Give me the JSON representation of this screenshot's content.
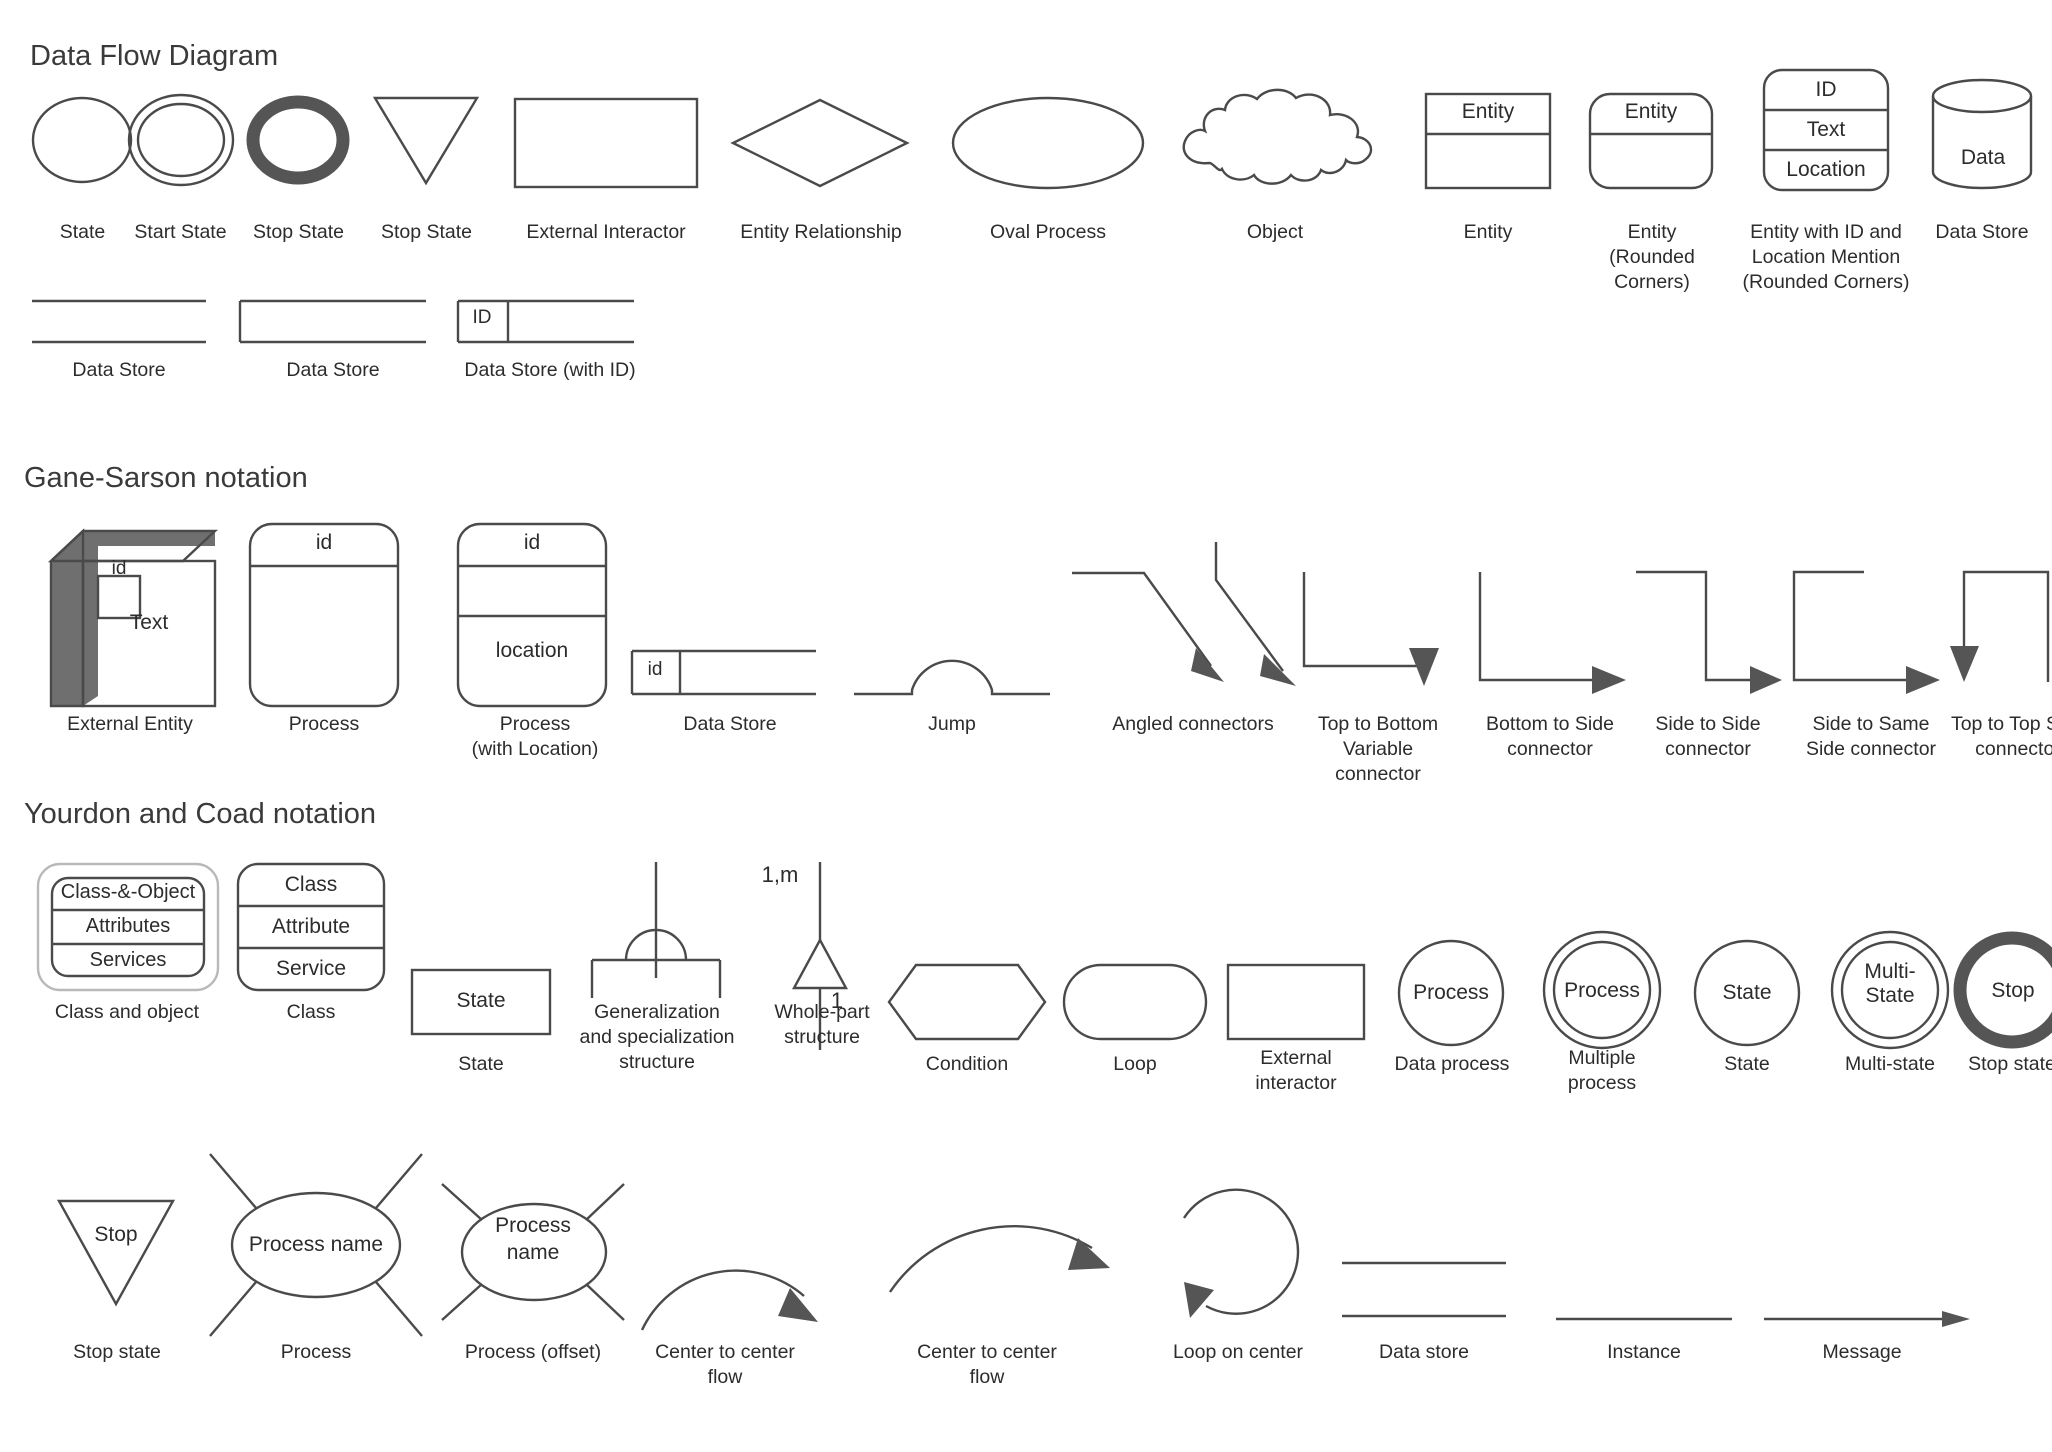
{
  "sections": [
    {
      "id": "dfd",
      "title": "Data Flow Diagram"
    },
    {
      "id": "gane",
      "title": "Gane-Sarson notation"
    },
    {
      "id": "yourdon",
      "title": "Yourdon and Coad notation"
    }
  ],
  "dfd": {
    "row1": [
      {
        "caption": "State",
        "shape": "ellipse"
      },
      {
        "caption": "Start State",
        "shape": "double-ellipse"
      },
      {
        "caption": "Stop State",
        "shape": "thick-ellipse"
      },
      {
        "caption": "Stop State",
        "shape": "down-triangle"
      },
      {
        "caption": "External Interactor",
        "shape": "rectangle"
      },
      {
        "caption": "Entity Relationship",
        "shape": "diamond"
      },
      {
        "caption": "Oval Process",
        "shape": "oval"
      },
      {
        "caption": "Object",
        "shape": "cloud"
      },
      {
        "caption": "Entity",
        "shape": "entity-box",
        "inner": "Entity"
      },
      {
        "caption": "Entity\n(Rounded Corners)",
        "shape": "entity-box-rounded",
        "inner": "Entity"
      },
      {
        "caption": "Entity with ID and\nLocation Mention\n(Rounded Corners)",
        "shape": "entity-three-rows",
        "rows": [
          "ID",
          "Text",
          "Location"
        ]
      },
      {
        "caption": "Data Store",
        "shape": "cylinder",
        "inner": "Data"
      }
    ],
    "row2": [
      {
        "caption": "Data Store",
        "shape": "two-lines"
      },
      {
        "caption": "Data Store",
        "shape": "open-rect"
      },
      {
        "caption": "Data Store (with ID)",
        "shape": "open-rect-id",
        "inner": "ID"
      }
    ]
  },
  "gane": {
    "items": [
      {
        "caption": "External Entity",
        "shape": "cube-3d",
        "inner_id": "id",
        "inner_text": "Text"
      },
      {
        "caption": "Process",
        "shape": "process-2row",
        "rows": [
          "id"
        ]
      },
      {
        "caption": "Process\n(with Location)",
        "shape": "process-3row",
        "rows": [
          "id",
          "",
          "location"
        ]
      },
      {
        "caption": "Data Store",
        "shape": "gane-datastore",
        "inner": "id"
      },
      {
        "caption": "Jump",
        "shape": "jump"
      },
      {
        "caption": "Angled connectors",
        "shape": "angled-connectors"
      },
      {
        "caption": "Top to Bottom\nVariable\nconnector",
        "shape": "top-to-bottom-variable"
      },
      {
        "caption": "Bottom to Side\nconnector",
        "shape": "bottom-to-side"
      },
      {
        "caption": "Side to Side\nconnector",
        "shape": "side-to-side"
      },
      {
        "caption": "Side to Same\nSide connector",
        "shape": "side-to-same-side"
      },
      {
        "caption": "Top to Top Side\nconnector",
        "shape": "top-to-top-side"
      }
    ]
  },
  "yourdon": {
    "row1": [
      {
        "caption": "Class and object",
        "shape": "class-and-object",
        "rows": [
          "Class-&-Object",
          "Attributes",
          "Services"
        ]
      },
      {
        "caption": "Class",
        "shape": "class-box",
        "rows": [
          "Class",
          "Attribute",
          "Service"
        ]
      },
      {
        "caption": "State",
        "shape": "state-rect",
        "inner": "State"
      },
      {
        "caption": "Generalization\nand specialization\nstructure",
        "shape": "generalization"
      },
      {
        "caption": "Whole-part\nstructure",
        "shape": "whole-part",
        "top_label": "1,m",
        "bottom_label": "1"
      },
      {
        "caption": "Condition",
        "shape": "hexagon"
      },
      {
        "caption": "Loop",
        "shape": "stadium"
      },
      {
        "caption": "External\ninteractor",
        "shape": "rect-plain"
      },
      {
        "caption": "Data process",
        "shape": "circle",
        "inner": "Process"
      },
      {
        "caption": "Multiple\nprocess",
        "shape": "double-circle",
        "inner": "Process"
      },
      {
        "caption": "State",
        "shape": "circle",
        "inner": "State"
      },
      {
        "caption": "Multi-state",
        "shape": "double-circle",
        "inner": "Multi-\nState"
      },
      {
        "caption": "Stop state",
        "shape": "thick-ring",
        "inner": "Stop"
      }
    ],
    "row2": [
      {
        "caption": "Stop state",
        "shape": "triangle-stop",
        "inner": "Stop"
      },
      {
        "caption": "Process",
        "shape": "process-star",
        "inner": "Process name"
      },
      {
        "caption": "Process (offset)",
        "shape": "process-star-offset",
        "inner": "Process\nname"
      },
      {
        "caption": "Center to center\nflow",
        "shape": "arc-arrow-small"
      },
      {
        "caption": "Center to center\nflow",
        "shape": "arc-arrow-large"
      },
      {
        "caption": "Loop on center",
        "shape": "loop-circle-arrow"
      },
      {
        "caption": "Data store",
        "shape": "two-lines-wide"
      },
      {
        "caption": "Instance",
        "shape": "single-line"
      },
      {
        "caption": "Message",
        "shape": "line-arrow"
      }
    ]
  },
  "colors": {
    "stroke": "#4a4a4a",
    "title": "#3a3a3a",
    "caption": "#2c2c2c",
    "cube_face": "#6f6f6f",
    "thick": "#555555"
  }
}
